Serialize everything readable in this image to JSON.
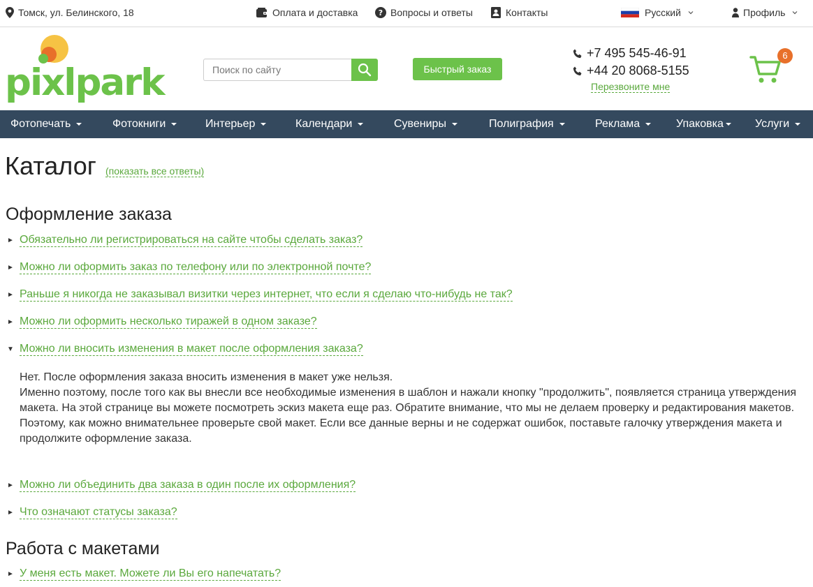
{
  "topbar": {
    "address": "Томск, ул. Белинского, 18",
    "payment": "Оплата и доставка",
    "faq": "Вопросы и ответы",
    "contacts": "Контакты",
    "language": "Русский",
    "profile": "Профиль"
  },
  "header": {
    "logo_text": "pixlpark",
    "search_placeholder": "Поиск по сайту",
    "quick_order": "Быстрый заказ",
    "phone1": "+7 495 545-46-91",
    "phone2": "+44 20 8068-5155",
    "callback": "Перезвоните мне",
    "cart_count": "6"
  },
  "nav": [
    "Фотопечать",
    "Фотокниги",
    "Интерьер",
    "Календари",
    "Сувениры",
    "Полиграфия",
    "Реклама",
    "Упаковка",
    "Услуги"
  ],
  "page": {
    "title": "Каталог",
    "show_all": "(показать все ответы)"
  },
  "sections": [
    {
      "title": "Оформление заказа",
      "questions": [
        "Обязательно ли регистрироваться на сайте чтобы сделать заказ?",
        "Можно ли оформить заказ по телефону или по электронной почте?",
        "Раньше я никогда не заказывал визитки через интернет, что если я сделаю что-нибудь не так?",
        "Можно ли оформить несколько тиражей в одном заказе?",
        "Можно ли вносить изменения в макет после оформления заказа?",
        "Можно ли объединить два заказа в один после их оформления?",
        "Что означают статусы заказа?"
      ],
      "answer_lines": [
        "Нет. После оформления заказа вносить изменения в макет уже нельзя.",
        "Именно поэтому, после того как вы внесли все необходимые изменения в шаблон и нажали кнопку \"продолжить\", появляется страница утверждения макета. На этой странице вы можете посмотреть эскиз макета еще раз. Обратите внимание, что мы не делаем проверку и редактирования макетов. Поэтому, как можно внимательнее проверьте свой макет. Если все данные верны и не содержат ошибок, поставьте галочку утверждения макета и продолжите оформление заказа."
      ]
    },
    {
      "title": "Работа с макетами",
      "questions": [
        "У меня есть макет. Можете ли Вы его напечатать?"
      ]
    }
  ],
  "colors": {
    "accent": "#6cc24a",
    "nav_bg": "#34495e",
    "badge": "#e8702a"
  }
}
